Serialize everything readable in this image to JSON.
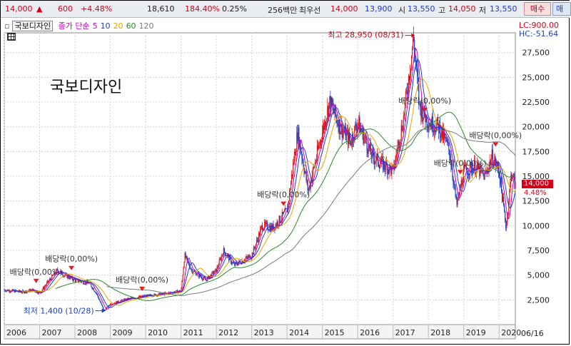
{
  "quote_bar": {
    "price": "14,000",
    "price_arrow": "▲",
    "change": "600",
    "change_pct": "+4.48%",
    "volume": "18,610",
    "volume_ratio": "184.40%",
    "turnover": "0.25%",
    "trade_value": "256백만",
    "best_bid_label": "최우선",
    "best_ask": "14,000",
    "best_bid": "13,900",
    "open_label": "시",
    "open": "13,550",
    "high_label": "고",
    "high": "14,050",
    "low_label": "저",
    "low": "13,550",
    "buy_label": "매수",
    "sell_label": "매도"
  },
  "legend": {
    "stock_name": "국보디자인",
    "ma_title": "종가 단순",
    "ma_periods": [
      "5",
      "10",
      "20",
      "60",
      "120"
    ],
    "ma_colors": [
      "#c000c0",
      "#1d3fc4",
      "#e8a400",
      "#2a8a2a",
      "#7a7a7a"
    ]
  },
  "overlay": {
    "stock_title": "국보디자인",
    "lc": "LC:900.00",
    "hc": "HC:-51.64",
    "last_price_tag": "14,000",
    "last_pct_tag": "4.48%",
    "date_label": "06/16"
  },
  "chart_data": {
    "type": "candlestick",
    "title": "",
    "x_ticks": [
      "2006",
      "2007",
      "2008",
      "2009",
      "2010",
      "2011",
      "2012",
      "2013",
      "2014",
      "2015",
      "2016",
      "2017",
      "2018",
      "2019",
      "2020"
    ],
    "y_ticks": [
      "2,500",
      "5,000",
      "7,500",
      "10,000",
      "12,500",
      "15,000",
      "17,500",
      "20,000",
      "22,500",
      "25,000",
      "27,500"
    ],
    "ylim": [
      0,
      29500
    ],
    "x_range": [
      2006.0,
      2020.46
    ],
    "grid": true,
    "moving_averages": [
      5,
      10,
      20,
      60,
      120
    ],
    "approx_close_series": [
      {
        "x": 2006.0,
        "y": 3500
      },
      {
        "x": 2006.5,
        "y": 3300
      },
      {
        "x": 2006.8,
        "y": 3500
      },
      {
        "x": 2007.0,
        "y": 3200
      },
      {
        "x": 2007.3,
        "y": 4600
      },
      {
        "x": 2007.5,
        "y": 5500
      },
      {
        "x": 2007.7,
        "y": 5000
      },
      {
        "x": 2008.0,
        "y": 4500
      },
      {
        "x": 2008.4,
        "y": 4200
      },
      {
        "x": 2008.6,
        "y": 3200
      },
      {
        "x": 2008.82,
        "y": 1400
      },
      {
        "x": 2009.0,
        "y": 2100
      },
      {
        "x": 2009.5,
        "y": 2600
      },
      {
        "x": 2010.0,
        "y": 2900
      },
      {
        "x": 2010.5,
        "y": 3100
      },
      {
        "x": 2011.0,
        "y": 3400
      },
      {
        "x": 2011.1,
        "y": 7000
      },
      {
        "x": 2011.3,
        "y": 5500
      },
      {
        "x": 2011.7,
        "y": 4500
      },
      {
        "x": 2012.0,
        "y": 5500
      },
      {
        "x": 2012.2,
        "y": 7500
      },
      {
        "x": 2012.5,
        "y": 6000
      },
      {
        "x": 2013.0,
        "y": 7000
      },
      {
        "x": 2013.3,
        "y": 10000
      },
      {
        "x": 2013.6,
        "y": 9800
      },
      {
        "x": 2014.0,
        "y": 11500
      },
      {
        "x": 2014.3,
        "y": 19500
      },
      {
        "x": 2014.6,
        "y": 13500
      },
      {
        "x": 2014.9,
        "y": 18000
      },
      {
        "x": 2015.2,
        "y": 22500
      },
      {
        "x": 2015.5,
        "y": 20000
      },
      {
        "x": 2015.8,
        "y": 18500
      },
      {
        "x": 2016.0,
        "y": 20500
      },
      {
        "x": 2016.4,
        "y": 17000
      },
      {
        "x": 2016.8,
        "y": 16000
      },
      {
        "x": 2017.0,
        "y": 15500
      },
      {
        "x": 2017.3,
        "y": 21000
      },
      {
        "x": 2017.58,
        "y": 28950
      },
      {
        "x": 2017.75,
        "y": 22000
      },
      {
        "x": 2018.0,
        "y": 20500
      },
      {
        "x": 2018.3,
        "y": 20000
      },
      {
        "x": 2018.6,
        "y": 17500
      },
      {
        "x": 2018.8,
        "y": 12000
      },
      {
        "x": 2019.0,
        "y": 15500
      },
      {
        "x": 2019.3,
        "y": 16000
      },
      {
        "x": 2019.6,
        "y": 15000
      },
      {
        "x": 2019.8,
        "y": 17000
      },
      {
        "x": 2020.0,
        "y": 15500
      },
      {
        "x": 2020.2,
        "y": 9800
      },
      {
        "x": 2020.35,
        "y": 15500
      },
      {
        "x": 2020.46,
        "y": 14000
      }
    ],
    "annotations": [
      {
        "text": "최고 28,950 (08/31)",
        "x": 2017.58,
        "y": 28950,
        "color": "#d0021b"
      },
      {
        "text": "최저 1,400 (10/28)",
        "x": 2008.82,
        "y": 1400,
        "color": "#1d3fc4"
      },
      {
        "text": "배당락(0,00%)",
        "x": 2006.9,
        "y": 4200
      },
      {
        "text": "배당락(0,00%)",
        "x": 2007.9,
        "y": 5500
      },
      {
        "text": "배당락(0,00%)",
        "x": 2009.9,
        "y": 3400
      },
      {
        "text": "배당락(0,00%)",
        "x": 2013.9,
        "y": 12000
      },
      {
        "text": "배당락(0,00%)",
        "x": 2017.9,
        "y": 21500
      },
      {
        "text": "배당락(0,00%)",
        "x": 2018.9,
        "y": 15200
      },
      {
        "text": "배당락(0,00%)",
        "x": 2019.9,
        "y": 18000
      }
    ]
  }
}
